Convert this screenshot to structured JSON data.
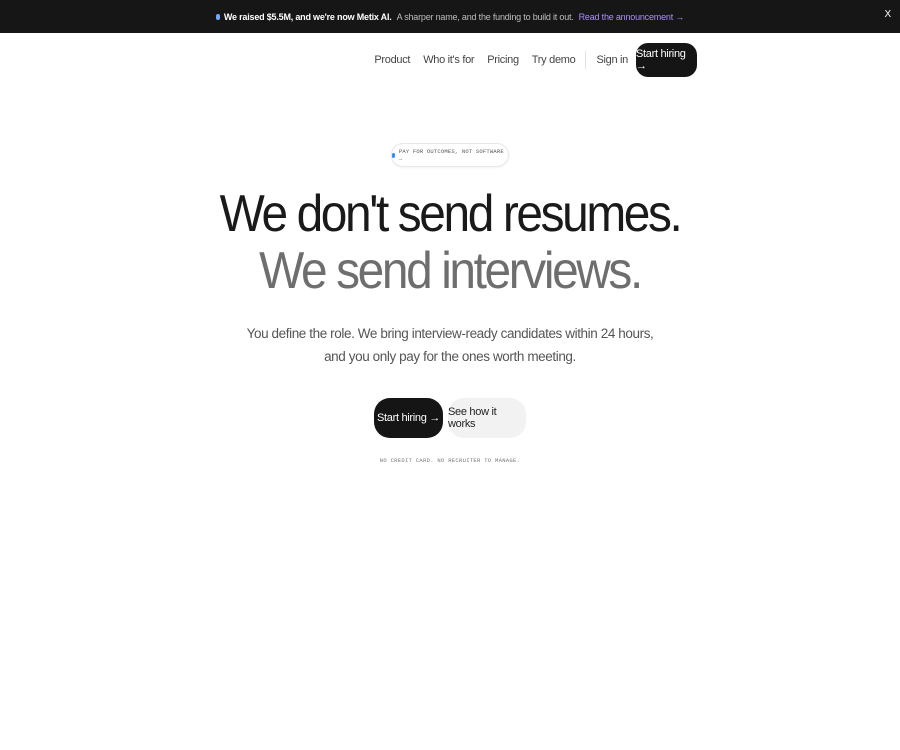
{
  "announcement": {
    "headline": "We raised $5.5M, and we're now Metix AI.",
    "sub": "A sharper name, and the funding to build it out.",
    "link": "Read the announcement →",
    "close": "X"
  },
  "nav": {
    "links": [
      "Product",
      "Who it's for",
      "Pricing",
      "Try demo"
    ],
    "signin": "Sign in",
    "cta": "Start hiring →"
  },
  "hero": {
    "pill": "PAY FOR OUTCOMES, NOT SOFTWARE →",
    "headline_1": "We don't send resumes.",
    "headline_2": "We send interviews.",
    "sub_1": "You define the role. We bring interview-ready candidates within 24 hours,",
    "sub_2": "and you only pay for the ones worth meeting.",
    "primary_button": "Start hiring →",
    "secondary_button": "See how it works",
    "fineprint": "NO CREDIT CARD. NO RECRUITER TO MANAGE."
  }
}
